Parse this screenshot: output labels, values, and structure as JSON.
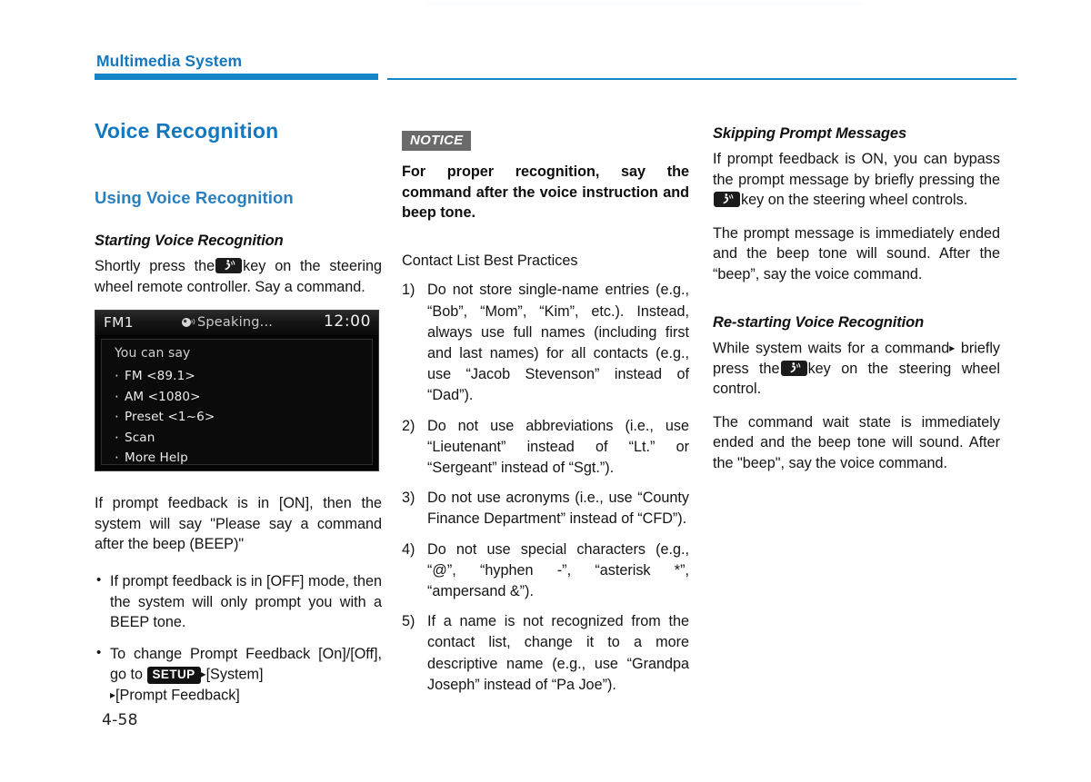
{
  "header": {
    "chapter_title": "Multimedia System",
    "accent_color": "#1585c6"
  },
  "folio": "4-58",
  "left_column": {
    "section_title": "Voice Recognition",
    "sub_title": "Using Voice Recognition",
    "topic_title": "Starting Voice Recognition",
    "intro_part_1": "Shortly press the",
    "intro_part_2": "key on the steering wheel remote controller. Say a command.",
    "after_screen_paragraph": "If prompt feedback is in [ON], then the system will say \"Please say a command after the beep (BEEP)\"",
    "bullets": [
      "If prompt feedback is in [OFF] mode, then the system will only prompt you with a BEEP tone.",
      "To change Prompt Feedback [On]/[Off], go to"
    ],
    "setup_badge": "SETUP",
    "setup_trail_1": "[System]",
    "setup_trail_2": "[Prompt Feedback]",
    "arrow": "▸"
  },
  "head_unit": {
    "source_label": "FM1",
    "status_text": "Speaking...",
    "clock": "12:00",
    "prompt_label": "You can say",
    "commands": [
      "FM <89.1>",
      "AM <1080>",
      "Preset <1~6>",
      "Scan",
      "More Help"
    ],
    "screen_bg": "#050505",
    "text_color": "#ebebeb"
  },
  "middle_column": {
    "notice_tag": "NOTICE",
    "notice_body": "For proper recognition, say the command after the voice instruction and beep tone.",
    "list_heading": "Contact List Best Practices",
    "numbered_items": [
      {
        "number": "1)",
        "text": "Do not store single-name entries (e.g., “Bob”, “Mom”, “Kim”, etc.). Instead, always use full names (including first and last names) for all contacts (e.g., use “Jacob Stevenson” instead of “Dad”)."
      },
      {
        "number": "2)",
        "text": "Do not use abbreviations (i.e., use “Lieutenant” instead of “Lt.” or “Sergeant” instead of “Sgt.”)."
      },
      {
        "number": "3)",
        "text": "Do not use acronyms (i.e., use “County Finance Department” instead of “CFD”)."
      },
      {
        "number": "4)",
        "text": "Do not use special characters (e.g., “@”, “hyphen -”, “asterisk *”, “ampersand &”)."
      },
      {
        "number": "5)",
        "text": "If a name is not recognized from the contact list, change it to a more descriptive name (e.g., use “Grandpa Joseph” instead of “Pa Joe”)."
      }
    ]
  },
  "right_column": {
    "topic_1_title": "Skipping Prompt Messages",
    "topic_1_para_a_part_1": "If prompt feedback is ON, you can bypass the prompt message by briefly pressing the",
    "topic_1_para_a_part_2": "key on the steering wheel controls.",
    "topic_1_para_b": "The prompt message is immediately ended and the beep tone will sound. After the “beep”, say the voice command.",
    "topic_2_title": "Re-starting Voice Recognition",
    "topic_2_para_a_part_1": "While system waits for a command",
    "topic_2_para_a_arrow": "▸",
    "topic_2_para_a_part_2": "briefly press the",
    "topic_2_para_a_part_3": "key on the steering wheel control.",
    "topic_2_para_b": "The command wait state is immediately ended and the beep tone will sound. After the \"beep\", say the voice command."
  }
}
